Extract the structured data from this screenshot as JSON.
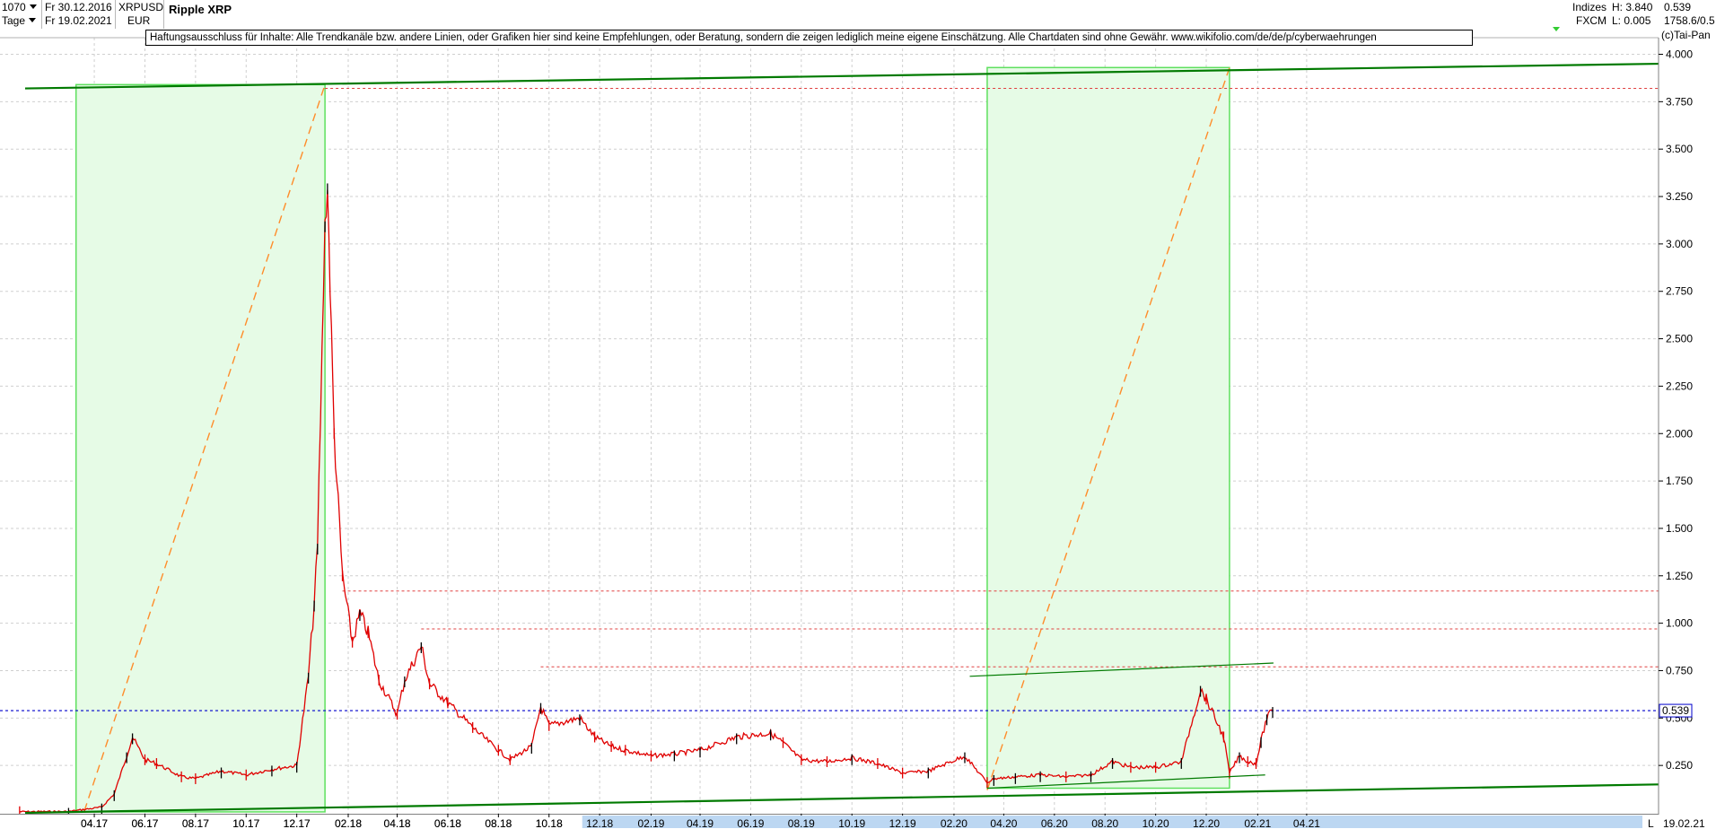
{
  "header": {
    "period_count": "1070",
    "interval": "Tage",
    "date_from": "Fr 30.12.2016",
    "date_to": "Fr 19.02.2021",
    "symbol": "XRPUSD",
    "currency": "EUR",
    "title": "Ripple XRP",
    "category": "Indizes",
    "source": "FXCM",
    "high_label": "H: 3.840",
    "low_label": "L: 0.005",
    "last_value": "0.539",
    "extra": "1758.6/0.5",
    "copyright": "(c)Tai-Pan"
  },
  "disclaimer": "Haftungsausschluss für Inhalte: Alle Trendkanäle bzw. andere Linien, oder Grafiken hier sind keine Empfehlungen, oder Beratung, sondern die zeigen lediglich meine eigene Einschätzung. Alle Chartdaten sind ohne Gewähr.  www.wikifolio.com/de/de/p/cyberwaehrungen",
  "scroll_right_label": "L",
  "current_date": "19.02.21",
  "price_tag": "0.539",
  "colors": {
    "price_down": "#e00000",
    "price_up": "#000000",
    "trend": "#007a00",
    "channel_fill": "#e6fbe6",
    "channel_border": "#5ee05e",
    "resistance": "#e04040",
    "current_price_line": "#0000cc",
    "target_line": "#ff8c2a",
    "scrollbar": "#bcd7f2"
  },
  "chart_data": {
    "type": "line",
    "title": "Ripple XRP",
    "ylim": [
      0.0,
      4.0
    ],
    "y_ticks": [
      "0.250",
      "0.500",
      "0.750",
      "1.000",
      "1.250",
      "1.500",
      "1.750",
      "2.000",
      "2.250",
      "2.500",
      "2.750",
      "3.000",
      "3.250",
      "3.500",
      "3.750",
      "4.000"
    ],
    "x_ticks": [
      "04.17",
      "06.17",
      "08.17",
      "10.17",
      "12.17",
      "02.18",
      "04.18",
      "06.18",
      "08.18",
      "10.18",
      "12.18",
      "02.19",
      "04.19",
      "06.19",
      "08.19",
      "10.19",
      "12.19",
      "02.20",
      "04.20",
      "06.20",
      "08.20",
      "10.20",
      "12.20",
      "02.21",
      "04.21"
    ],
    "grid": true,
    "series": [
      {
        "x": [
          "2017-01-01",
          "2017-03-01",
          "2017-04-10",
          "2017-04-25",
          "2017-05-10",
          "2017-05-17",
          "2017-06-01",
          "2017-06-15",
          "2017-07-15",
          "2017-08-01",
          "2017-09-01",
          "2017-10-01",
          "2017-11-01",
          "2017-12-01",
          "2017-12-15",
          "2017-12-22",
          "2017-12-26",
          "2018-01-04",
          "2018-01-07",
          "2018-01-15",
          "2018-01-25",
          "2018-02-06",
          "2018-02-15",
          "2018-02-25",
          "2018-03-10",
          "2018-04-01",
          "2018-04-10",
          "2018-04-30",
          "2018-05-10",
          "2018-06-01",
          "2018-07-01",
          "2018-08-01",
          "2018-08-15",
          "2018-09-10",
          "2018-09-21",
          "2018-10-01",
          "2018-11-07",
          "2018-11-25",
          "2018-12-15",
          "2019-01-01",
          "2019-02-01",
          "2019-03-01",
          "2019-04-01",
          "2019-05-15",
          "2019-06-25",
          "2019-07-10",
          "2019-08-01",
          "2019-09-01",
          "2019-10-01",
          "2019-11-01",
          "2019-12-01",
          "2020-01-01",
          "2020-02-14",
          "2020-03-12",
          "2020-03-20",
          "2020-04-15",
          "2020-05-15",
          "2020-06-15",
          "2020-07-15",
          "2020-08-10",
          "2020-09-01",
          "2020-10-01",
          "2020-11-01",
          "2020-11-24",
          "2020-12-01",
          "2020-12-22",
          "2020-12-29",
          "2021-01-10",
          "2021-01-20",
          "2021-01-30",
          "2021-02-05",
          "2021-02-12",
          "2021-02-19"
        ],
        "y": [
          0.006,
          0.007,
          0.03,
          0.1,
          0.3,
          0.4,
          0.28,
          0.26,
          0.19,
          0.18,
          0.22,
          0.2,
          0.23,
          0.25,
          0.72,
          1.1,
          1.4,
          3.1,
          3.3,
          2.0,
          1.25,
          0.9,
          1.05,
          0.95,
          0.7,
          0.52,
          0.7,
          0.88,
          0.68,
          0.58,
          0.45,
          0.33,
          0.28,
          0.35,
          0.56,
          0.46,
          0.5,
          0.4,
          0.35,
          0.33,
          0.3,
          0.31,
          0.33,
          0.4,
          0.42,
          0.37,
          0.28,
          0.27,
          0.29,
          0.26,
          0.21,
          0.22,
          0.3,
          0.16,
          0.18,
          0.19,
          0.2,
          0.19,
          0.2,
          0.27,
          0.24,
          0.24,
          0.27,
          0.65,
          0.6,
          0.4,
          0.21,
          0.3,
          0.27,
          0.26,
          0.38,
          0.5,
          0.539
        ]
      }
    ],
    "resistance_levels": [
      3.82,
      1.17,
      0.97,
      0.77
    ],
    "current_price": 0.539,
    "high": 3.84,
    "low": 0.005
  }
}
